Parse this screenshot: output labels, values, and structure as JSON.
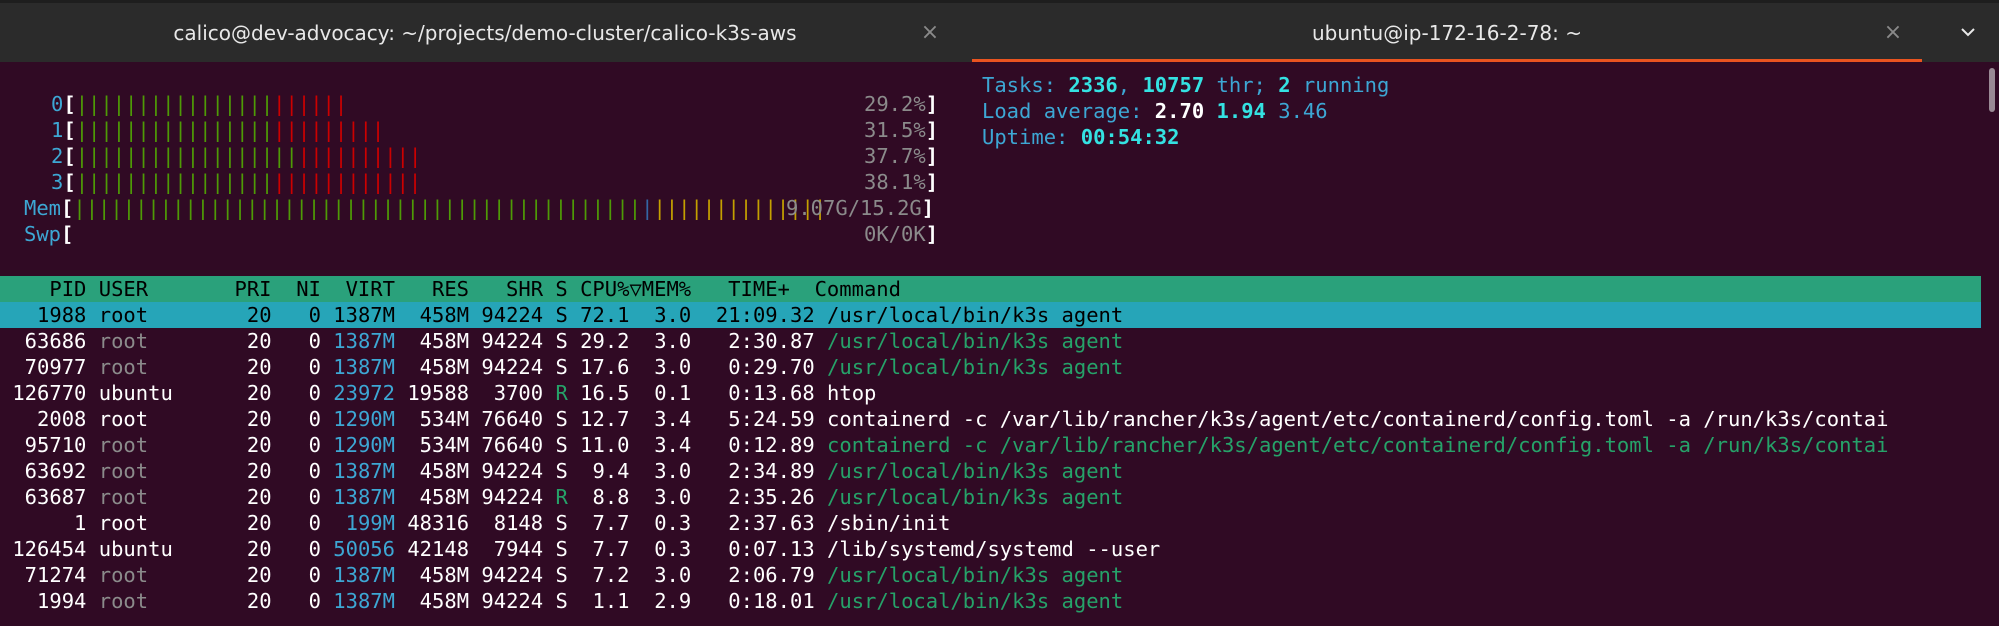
{
  "tabs": [
    {
      "title": "calico@dev-advocacy: ~/projects/demo-cluster/calico-k3s-aws",
      "close": "×",
      "active": false
    },
    {
      "title": "ubuntu@ip-172-16-2-78: ~",
      "close": "×",
      "active": true
    }
  ],
  "menu_icon": "chevron-down",
  "colors": {
    "terminal_bg": "#300a24",
    "tab_accent": "#e95420",
    "header_bg": "#2aa17b",
    "selected_bg": "#26a5b8"
  },
  "meters": {
    "cpu": [
      {
        "id": "0",
        "green": "||||||||||||||||",
        "red": "||||||",
        "pct": "29.2%"
      },
      {
        "id": "1",
        "green": "||||||||||||||||",
        "red": "|||||||||",
        "pct": "31.5%"
      },
      {
        "id": "2",
        "green": "||||||||||||||||||",
        "red": "||||||||||",
        "pct": "37.7%"
      },
      {
        "id": "3",
        "green": "||||||||||||||||",
        "red": "||||||||||||",
        "pct": "38.1%"
      }
    ],
    "mem": {
      "label": "Mem",
      "green": "||||||||||||||||||||||||||||||||||||||||||||||",
      "blue": "|",
      "orange": "||||||||||||||",
      "value": "9.07G/15.2G"
    },
    "swp": {
      "label": "Swp",
      "value": "0K/0K"
    }
  },
  "summary": {
    "tasks_label": "Tasks: ",
    "tasks": "2336",
    "thr": "10757",
    "thr_label": " thr; ",
    "running": "2",
    "running_label": " running",
    "load_label": "Load average: ",
    "load1": "2.70",
    "load5": "1.94",
    "load15": "3.46",
    "uptime_label": "Uptime: ",
    "uptime": "00:54:32"
  },
  "table_header": "    PID USER       PRI  NI  VIRT   RES   SHR S CPU%▽MEM%   TIME+  Command",
  "processes": [
    {
      "pid": "1988",
      "user": "root",
      "pri": "20",
      "ni": "0",
      "virt": "1387M",
      "res": "458M",
      "shr": "94224",
      "s": "S",
      "cpu": "72.1",
      "mem": "3.0",
      "time": "21:09.32",
      "cmd": "/usr/local/bin/k3s agent",
      "thread": false
    },
    {
      "pid": "63686",
      "user": "root",
      "pri": "20",
      "ni": "0",
      "virt": "1387M",
      "res": "458M",
      "shr": "94224",
      "s": "S",
      "cpu": "29.2",
      "mem": "3.0",
      "time": "2:30.87",
      "cmd": "/usr/local/bin/k3s agent",
      "thread": true
    },
    {
      "pid": "70977",
      "user": "root",
      "pri": "20",
      "ni": "0",
      "virt": "1387M",
      "res": "458M",
      "shr": "94224",
      "s": "S",
      "cpu": "17.6",
      "mem": "3.0",
      "time": "0:29.70",
      "cmd": "/usr/local/bin/k3s agent",
      "thread": true
    },
    {
      "pid": "126770",
      "user": "ubuntu",
      "pri": "20",
      "ni": "0",
      "virt": "23972",
      "res": "19588",
      "shr": "3700",
      "s": "R",
      "cpu": "16.5",
      "mem": "0.1",
      "time": "0:13.68",
      "cmd": "htop",
      "thread": false
    },
    {
      "pid": "2008",
      "user": "root",
      "pri": "20",
      "ni": "0",
      "virt": "1290M",
      "res": "534M",
      "shr": "76640",
      "s": "S",
      "cpu": "12.7",
      "mem": "3.4",
      "time": "5:24.59",
      "cmd": "containerd -c /var/lib/rancher/k3s/agent/etc/containerd/config.toml -a /run/k3s/contai",
      "thread": false
    },
    {
      "pid": "95710",
      "user": "root",
      "pri": "20",
      "ni": "0",
      "virt": "1290M",
      "res": "534M",
      "shr": "76640",
      "s": "S",
      "cpu": "11.0",
      "mem": "3.4",
      "time": "0:12.89",
      "cmd": "containerd -c /var/lib/rancher/k3s/agent/etc/containerd/config.toml -a /run/k3s/contai",
      "thread": true
    },
    {
      "pid": "63692",
      "user": "root",
      "pri": "20",
      "ni": "0",
      "virt": "1387M",
      "res": "458M",
      "shr": "94224",
      "s": "S",
      "cpu": "9.4",
      "mem": "3.0",
      "time": "2:34.89",
      "cmd": "/usr/local/bin/k3s agent",
      "thread": true
    },
    {
      "pid": "63687",
      "user": "root",
      "pri": "20",
      "ni": "0",
      "virt": "1387M",
      "res": "458M",
      "shr": "94224",
      "s": "R",
      "cpu": "8.8",
      "mem": "3.0",
      "time": "2:35.26",
      "cmd": "/usr/local/bin/k3s agent",
      "thread": true
    },
    {
      "pid": "1",
      "user": "root",
      "pri": "20",
      "ni": "0",
      "virt": "199M",
      "res": "48316",
      "shr": "8148",
      "s": "S",
      "cpu": "7.7",
      "mem": "0.3",
      "time": "2:37.63",
      "cmd": "/sbin/init",
      "thread": false
    },
    {
      "pid": "126454",
      "user": "ubuntu",
      "pri": "20",
      "ni": "0",
      "virt": "50056",
      "res": "42148",
      "shr": "7944",
      "s": "S",
      "cpu": "7.7",
      "mem": "0.3",
      "time": "0:07.13",
      "cmd": "/lib/systemd/systemd --user",
      "thread": false
    },
    {
      "pid": "71274",
      "user": "root",
      "pri": "20",
      "ni": "0",
      "virt": "1387M",
      "res": "458M",
      "shr": "94224",
      "s": "S",
      "cpu": "7.2",
      "mem": "3.0",
      "time": "2:06.79",
      "cmd": "/usr/local/bin/k3s agent",
      "thread": true
    },
    {
      "pid": "1994",
      "user": "root",
      "pri": "20",
      "ni": "0",
      "virt": "1387M",
      "res": "458M",
      "shr": "94224",
      "s": "S",
      "cpu": "1.1",
      "mem": "2.9",
      "time": "0:18.01",
      "cmd": "/usr/local/bin/k3s agent",
      "thread": true
    }
  ]
}
